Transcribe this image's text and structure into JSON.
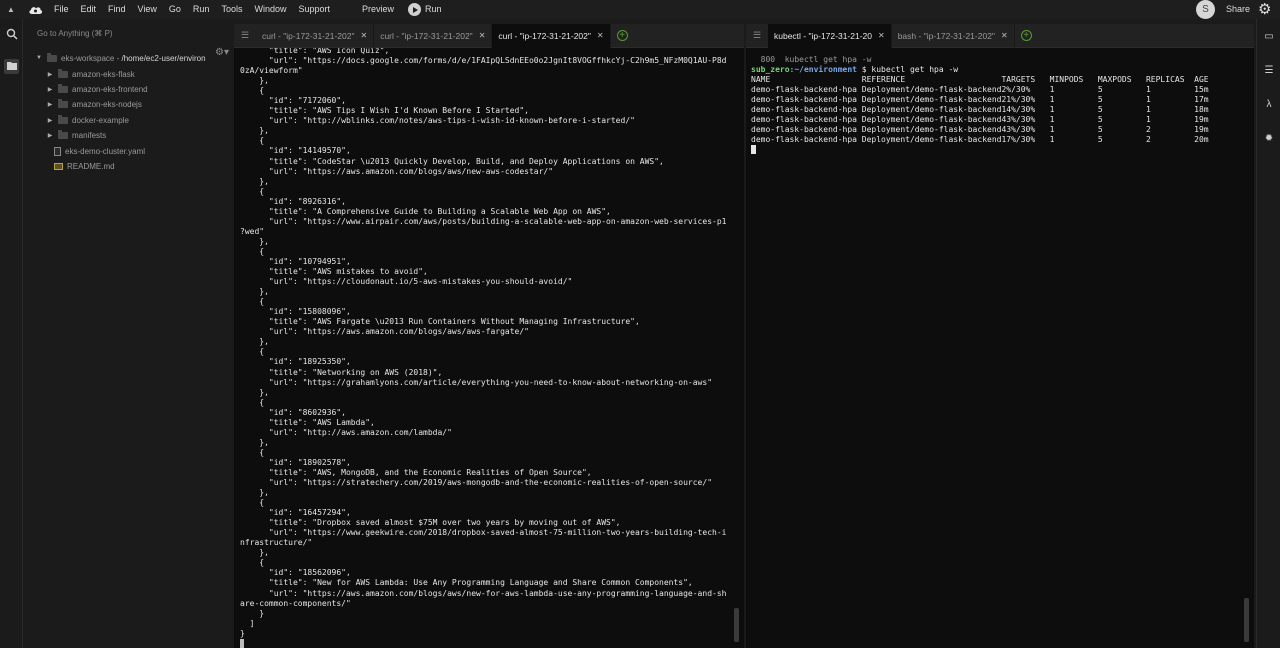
{
  "menubar": {
    "items": [
      "File",
      "Edit",
      "Find",
      "View",
      "Go",
      "Run",
      "Tools",
      "Window",
      "Support"
    ],
    "preview": "Preview",
    "run": "Run",
    "avatar_initial": "S",
    "share": "Share"
  },
  "sidebar": {
    "goto_placeholder": "Go to Anything (⌘ P)",
    "workspace": {
      "name": "eks-workspace",
      "separator": " - ",
      "path": "/home/ec2-user/environ"
    },
    "items": [
      {
        "label": "amazon-eks-flask",
        "type": "folder"
      },
      {
        "label": "amazon-eks-frontend",
        "type": "folder"
      },
      {
        "label": "amazon-eks-nodejs",
        "type": "folder"
      },
      {
        "label": "docker-example",
        "type": "folder"
      },
      {
        "label": "manifests",
        "type": "folder"
      },
      {
        "label": "eks-demo-cluster.yaml",
        "type": "file"
      },
      {
        "label": "README.md",
        "type": "markdown"
      }
    ]
  },
  "left_pane": {
    "tabs": [
      {
        "label": "curl - \"ip-172-31-21-202\"",
        "active": false
      },
      {
        "label": "curl - \"ip-172-31-21-202\"",
        "active": false
      },
      {
        "label": "curl - \"ip-172-31-21-202\"",
        "active": true
      }
    ],
    "lines": [
      "      \"title\": \"AWS Icon Quiz\",",
      "      \"url\": \"https://docs.google.com/forms/d/e/1FAIpQLSdnEEo0o2JgnIt8VOGffhkcYj-C2h9m5_NFzM0Q1AU-P8d",
      "0zA/viewform\"",
      "    },",
      "    {",
      "      \"id\": \"7172060\",",
      "      \"title\": \"AWS Tips I Wish I'd Known Before I Started\",",
      "      \"url\": \"http://wblinks.com/notes/aws-tips-i-wish-id-known-before-i-started/\"",
      "    },",
      "    {",
      "      \"id\": \"14149570\",",
      "      \"title\": \"CodeStar \\u2013 Quickly Develop, Build, and Deploy Applications on AWS\",",
      "      \"url\": \"https://aws.amazon.com/blogs/aws/new-aws-codestar/\"",
      "    },",
      "    {",
      "      \"id\": \"8926316\",",
      "      \"title\": \"A Comprehensive Guide to Building a Scalable Web App on AWS\",",
      "      \"url\": \"https://www.airpair.com/aws/posts/building-a-scalable-web-app-on-amazon-web-services-p1",
      "?wed\"",
      "    },",
      "    {",
      "      \"id\": \"10794951\",",
      "      \"title\": \"AWS mistakes to avoid\",",
      "      \"url\": \"https://cloudonaut.io/5-aws-mistakes-you-should-avoid/\"",
      "    },",
      "    {",
      "      \"id\": \"15808096\",",
      "      \"title\": \"AWS Fargate \\u2013 Run Containers Without Managing Infrastructure\",",
      "      \"url\": \"https://aws.amazon.com/blogs/aws/aws-fargate/\"",
      "    },",
      "    {",
      "      \"id\": \"18925350\",",
      "      \"title\": \"Networking on AWS (2018)\",",
      "      \"url\": \"https://grahamlyons.com/article/everything-you-need-to-know-about-networking-on-aws\"",
      "    },",
      "    {",
      "      \"id\": \"8602936\",",
      "      \"title\": \"AWS Lambda\",",
      "      \"url\": \"http://aws.amazon.com/lambda/\"",
      "    },",
      "    {",
      "      \"id\": \"18902578\",",
      "      \"title\": \"AWS, MongoDB, and the Economic Realities of Open Source\",",
      "      \"url\": \"https://stratechery.com/2019/aws-mongodb-and-the-economic-realities-of-open-source/\"",
      "    },",
      "    {",
      "      \"id\": \"16457294\",",
      "      \"title\": \"Dropbox saved almost $75M over two years by moving out of AWS\",",
      "      \"url\": \"https://www.geekwire.com/2018/dropbox-saved-almost-75-million-two-years-building-tech-i",
      "nfrastructure/\"",
      "    },",
      "    {",
      "      \"id\": \"18562096\",",
      "      \"title\": \"New for AWS Lambda: Use Any Programming Language and Share Common Components\",",
      "      \"url\": \"https://aws.amazon.com/blogs/aws/new-for-aws-lambda-use-any-programming-language-and-sh",
      "are-common-components/\"",
      "    }",
      "  ]",
      "}"
    ]
  },
  "right_pane": {
    "tabs": [
      {
        "label": "kubectl - \"ip-172-31-21-20",
        "active": true
      },
      {
        "label": "bash - \"ip-172-31-21-202\"",
        "active": false
      }
    ],
    "prev_line": "  800  kubectl get hpa -w",
    "prompt_user": "sub_zero",
    "prompt_path": ":~/environment",
    "prompt_symbol": " $ ",
    "command": "kubectl get hpa -w",
    "columns": [
      "NAME",
      "REFERENCE",
      "TARGETS",
      "MINPODS",
      "MAXPODS",
      "REPLICAS",
      "AGE"
    ],
    "rows": [
      [
        "demo-flask-backend-hpa",
        "Deployment/demo-flask-backend",
        "2%/30%",
        "1",
        "5",
        "1",
        "15m"
      ],
      [
        "demo-flask-backend-hpa",
        "Deployment/demo-flask-backend",
        "21%/30%",
        "1",
        "5",
        "1",
        "17m"
      ],
      [
        "demo-flask-backend-hpa",
        "Deployment/demo-flask-backend",
        "14%/30%",
        "1",
        "5",
        "1",
        "18m"
      ],
      [
        "demo-flask-backend-hpa",
        "Deployment/demo-flask-backend",
        "43%/30%",
        "1",
        "5",
        "1",
        "19m"
      ],
      [
        "demo-flask-backend-hpa",
        "Deployment/demo-flask-backend",
        "43%/30%",
        "1",
        "5",
        "2",
        "19m"
      ],
      [
        "demo-flask-backend-hpa",
        "Deployment/demo-flask-backend",
        "17%/30%",
        "1",
        "5",
        "2",
        "20m"
      ]
    ]
  },
  "colors": {
    "background": "#0d0d0d",
    "prompt_user": "#7ad47a",
    "prompt_path": "#7aa8e6",
    "add_tab": "#5a9a3a"
  }
}
